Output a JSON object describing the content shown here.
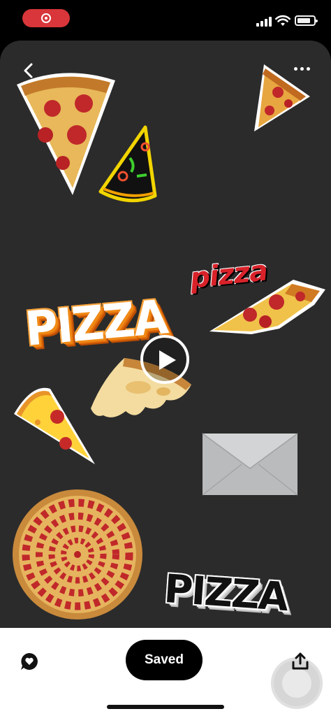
{
  "status_bar": {
    "recording_icon": "screen-record-icon",
    "signal_icon": "cellular-signal-icon",
    "wifi_icon": "wifi-icon",
    "battery_icon": "battery-icon"
  },
  "header": {
    "back_icon": "chevron-left-icon",
    "more_icon": "more-horizontal-icon"
  },
  "stickers": {
    "word_red": "pizza",
    "word_orange": "PIZZA",
    "word_black": "PIZZA"
  },
  "video": {
    "play_icon": "play-icon"
  },
  "bottom_bar": {
    "reaction_icon": "heart-bubble-icon",
    "saved_label": "Saved",
    "share_icon": "share-icon"
  },
  "colors": {
    "canvas": "#2b2b2b",
    "record_pill": "#d8363a",
    "saved_button": "#000000"
  }
}
